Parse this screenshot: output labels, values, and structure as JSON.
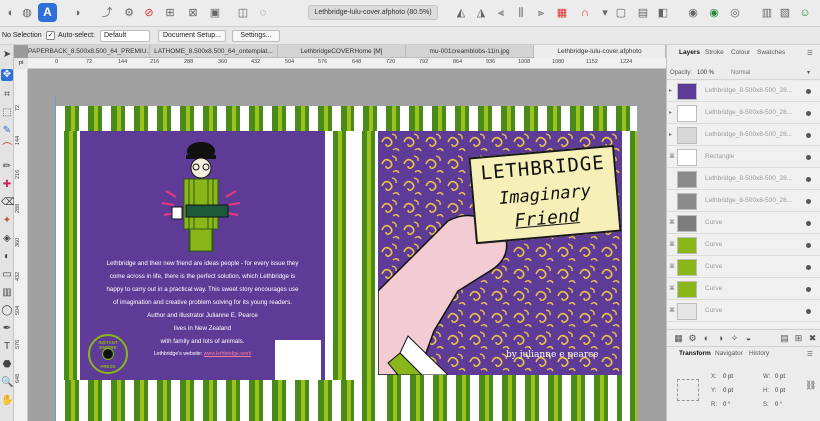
{
  "toolbar": {
    "document_title": "Lethbridge-lulu-cover.afphoto (80.5%)"
  },
  "context_bar": {
    "selection": "No Selection",
    "auto_select_label": "Auto-select:",
    "auto_select_value": "Default",
    "document_setup": "Document Setup...",
    "settings": "Settings..."
  },
  "tabs": [
    "PAPERBACK_8.500x8.500_64_PREMIU...",
    "LATHOME_8.500x8.500_64_ontemplat...",
    "LethbridgeCOVERHome [M]",
    "mu-001creamblobs-11in.jpg",
    "Lethbridge-lulu-cover.afphoto"
  ],
  "ruler": {
    "unit": "pt",
    "h_ticks": [
      "0",
      "72",
      "144",
      "216",
      "288",
      "360",
      "432",
      "504",
      "576",
      "648",
      "720",
      "792",
      "864",
      "936",
      "1008",
      "1080",
      "1152",
      "1224"
    ],
    "v_ticks": [
      "72",
      "144",
      "216",
      "288",
      "360",
      "432",
      "504",
      "576",
      "648"
    ]
  },
  "back_cover": {
    "lines": [
      "Lethbridge and their new friend are ideas people - for every issue they",
      "come across in life, there is the perfect solution, which Lethbridge is",
      "happy to carry out in a practical way. This sweet story encourages use",
      "of imagination and creative problem solving for its young readers.",
      "Author and illustrator Julianne E. Pearce",
      "lives in New Zealand",
      "with family and lots of animals."
    ],
    "website_prefix": "Lethbridge's website:",
    "website_link": "www.lethbridge.work",
    "press_text_top": "INSTANT EMPIRE",
    "press_text_bottom": "PRESS"
  },
  "front_cover": {
    "title_line1": "LETHBRIDGE",
    "title_line2": "Imaginary",
    "title_line3": "Friend",
    "byline": "by julianne e pearce"
  },
  "panel": {
    "tabs": [
      "Layers",
      "Stroke",
      "Colour",
      "Swatches"
    ],
    "opacity_label": "Opacity:",
    "opacity_value": "100 %",
    "blend_mode": "Normal",
    "layers": [
      "Lethbridge_8-500x8-500_28...",
      "Lethbridge_8-500x8-500_28...",
      "Lethbridge_8-500x8-500_28...",
      "Rectangle",
      "Lethbridge_8-500x8-500_28...",
      "Lethbridge_8-500x8-500_28...",
      "Curve",
      "Curve",
      "Curve",
      "Curve",
      "Curve"
    ],
    "transform_tabs": [
      "Transform",
      "Navigator",
      "History"
    ],
    "transform": {
      "x_label": "X:",
      "x_value": "0 pt",
      "y_label": "Y:",
      "y_value": "0 pt",
      "w_label": "W:",
      "w_value": "0 pt",
      "h_label": "H:",
      "h_value": "0 pt",
      "r_label": "R:",
      "r_value": "0 °",
      "s_label": "S:",
      "s_value": "0 °"
    }
  },
  "colors": {
    "purple": "#5e3b96",
    "green_dark": "#4a8a1b",
    "green_light": "#9cc21c",
    "card": "#f6efb8",
    "accent": "#2f6fd8"
  }
}
